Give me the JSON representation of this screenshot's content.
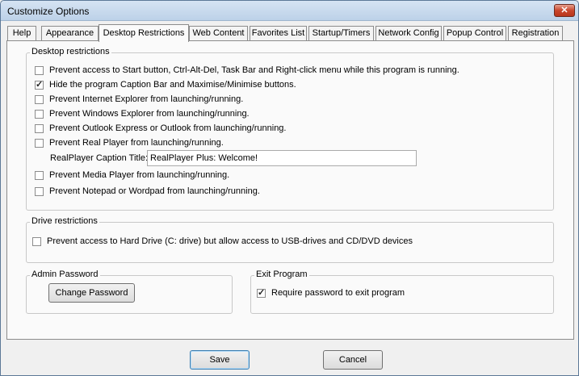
{
  "window": {
    "title": "Customize Options",
    "close_label": "✕"
  },
  "tabs": [
    {
      "label": "Help"
    },
    {
      "label": "Appearance"
    },
    {
      "label": "Desktop Restrictions",
      "active": true
    },
    {
      "label": "Web Content"
    },
    {
      "label": "Favorites List"
    },
    {
      "label": "Startup/Timers"
    },
    {
      "label": "Network Config"
    },
    {
      "label": "Popup Control"
    },
    {
      "label": "Registration"
    }
  ],
  "desktop_restrictions": {
    "legend": "Desktop restrictions",
    "options": [
      {
        "label": "Prevent access to Start button, Ctrl-Alt-Del, Task Bar and Right-click menu while this program is running.",
        "checked": false
      },
      {
        "label": "Hide the program Caption Bar and Maximise/Minimise buttons.",
        "checked": true
      },
      {
        "label": "Prevent Internet Explorer from launching/running.",
        "checked": false
      },
      {
        "label": "Prevent Windows Explorer from launching/running.",
        "checked": false
      },
      {
        "label": "Prevent Outlook Express or Outlook from launching/running.",
        "checked": false
      },
      {
        "label": "Prevent Real Player from launching/running.",
        "checked": false
      },
      {
        "label": "Prevent Media Player from launching/running.",
        "checked": false
      },
      {
        "label": "Prevent Notepad or Wordpad from launching/running.",
        "checked": false
      }
    ],
    "realplayer_caption": {
      "label": "RealPlayer Caption Title:",
      "value": "RealPlayer Plus: Welcome!"
    }
  },
  "drive_restrictions": {
    "legend": "Drive restrictions",
    "option": {
      "label": "Prevent access to Hard Drive (C: drive) but allow access to USB-drives and CD/DVD devices",
      "checked": false
    }
  },
  "admin_password": {
    "legend": "Admin Password",
    "button_label": "Change Password"
  },
  "exit_program": {
    "legend": "Exit Program",
    "option": {
      "label": "Require password to exit program",
      "checked": true
    }
  },
  "footer": {
    "save_label": "Save",
    "cancel_label": "Cancel"
  }
}
